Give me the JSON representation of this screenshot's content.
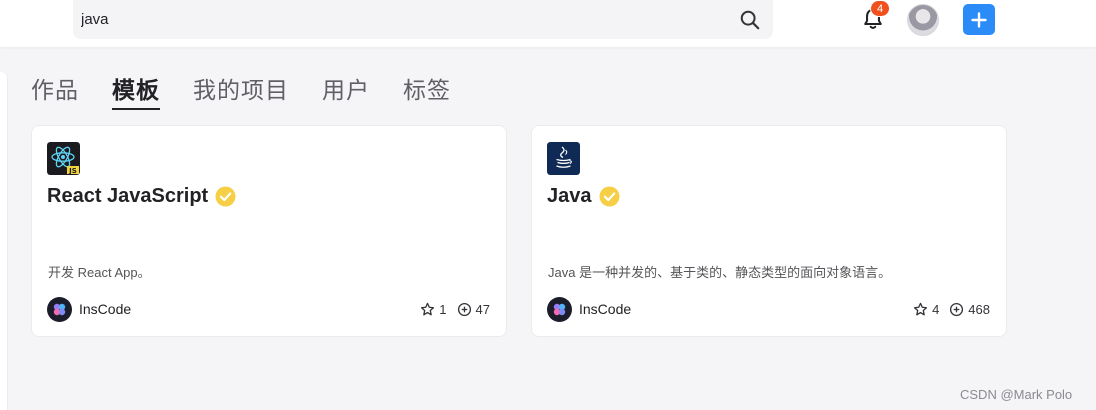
{
  "header": {
    "search_value": "java",
    "search_icon": "search-icon",
    "notification_icon": "bell-icon",
    "notification_count": "4",
    "add_icon": "plus-icon",
    "accent_color": "#2b8bf7",
    "badge_color": "#f0501e"
  },
  "tabs": [
    {
      "label": "作品",
      "active": false
    },
    {
      "label": "模板",
      "active": true
    },
    {
      "label": "我的项目",
      "active": false
    },
    {
      "label": "用户",
      "active": false
    },
    {
      "label": "标签",
      "active": false
    }
  ],
  "cards": [
    {
      "logo_icon": "react-js-logo-icon",
      "title": "React JavaScript",
      "verified": true,
      "description": "开发 React App。",
      "owner": "InsCode",
      "stars": "1",
      "forks": "47"
    },
    {
      "logo_icon": "java-logo-icon",
      "title": "Java",
      "verified": true,
      "description": "Java 是一种并发的、基于类的、静态类型的面向对象语言。",
      "owner": "InsCode",
      "stars": "4",
      "forks": "468"
    }
  ],
  "watermark": "CSDN @Mark Polo"
}
